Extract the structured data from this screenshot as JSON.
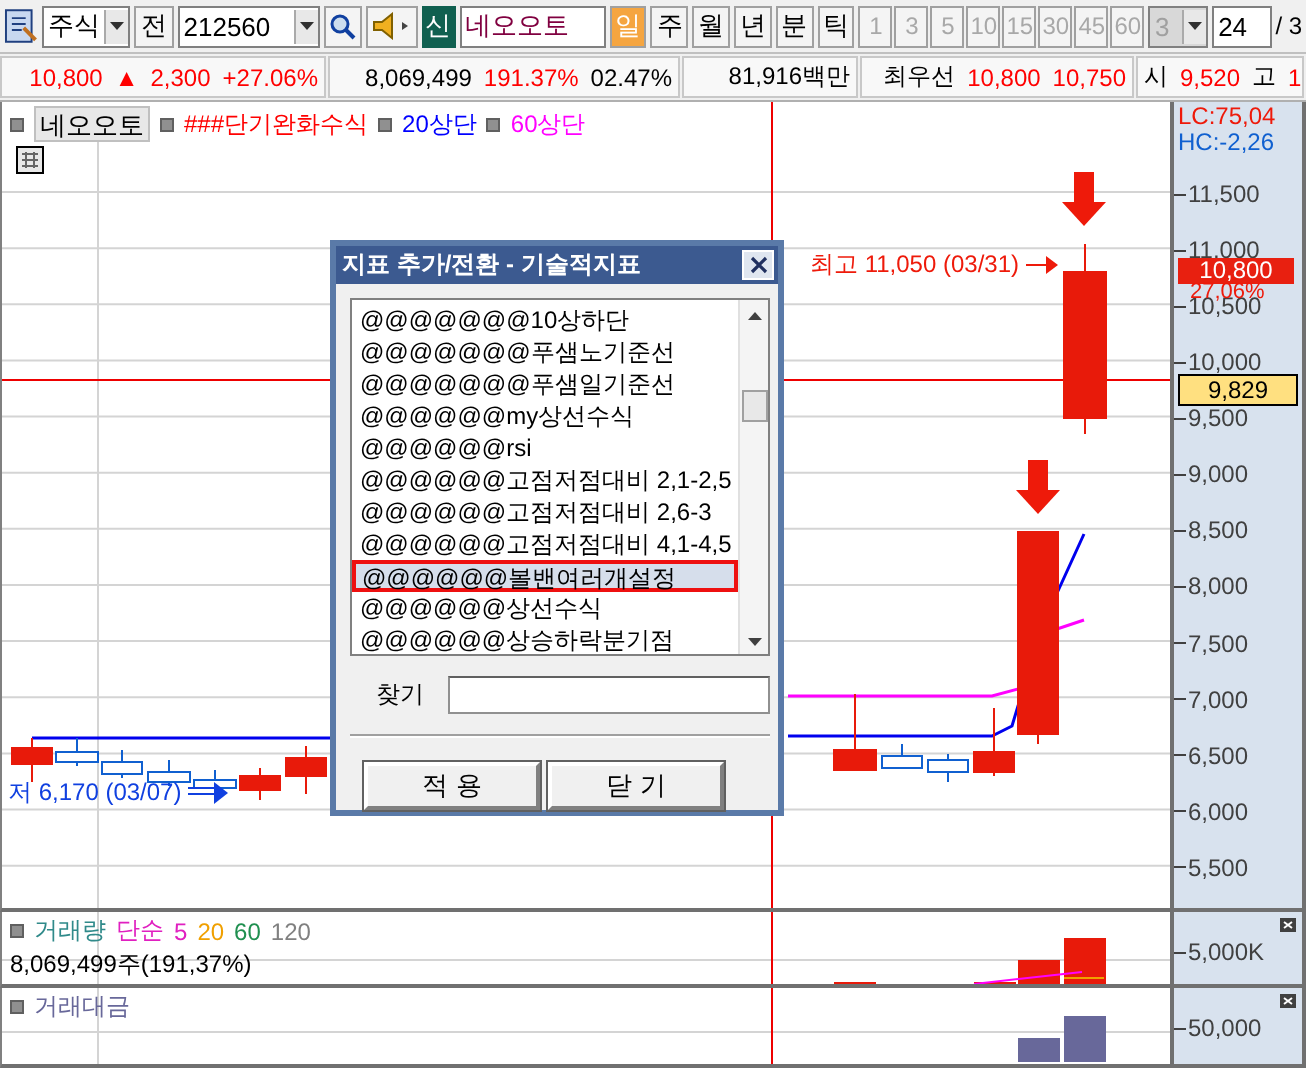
{
  "toolbar": {
    "market": "주식",
    "prev_button": "전",
    "code": "212560",
    "badge": "신",
    "name": "네오오토",
    "periods": [
      {
        "label": "일",
        "selected": true
      },
      {
        "label": "주",
        "selected": false
      },
      {
        "label": "월",
        "selected": false
      },
      {
        "label": "년",
        "selected": false
      },
      {
        "label": "분",
        "selected": false
      },
      {
        "label": "틱",
        "selected": false
      }
    ],
    "intervals": [
      {
        "label": "1",
        "disabled": true
      },
      {
        "label": "3",
        "disabled": true
      },
      {
        "label": "5",
        "disabled": true
      },
      {
        "label": "10",
        "disabled": true
      },
      {
        "label": "15",
        "disabled": true
      },
      {
        "label": "30",
        "disabled": true
      },
      {
        "label": "45",
        "disabled": true
      },
      {
        "label": "60",
        "disabled": true
      }
    ],
    "interval_select": {
      "value": "3",
      "disabled": true
    },
    "count": "24",
    "page": "/ 3"
  },
  "quote": {
    "price": "10,800",
    "change_sign": "▲",
    "change": "2,300",
    "change_pct": "+27.06%",
    "volume": "8,069,499",
    "volume_ratio": "191.37%",
    "turnover": "02.47%",
    "amount": "81,916백만",
    "best_label": "최우선",
    "best_ask": "10,800",
    "best_bid": "10,750",
    "open_label": "시",
    "open": "9,520",
    "high_label": "고",
    "high": "1"
  },
  "price_panel": {
    "legend": [
      {
        "label": "네오오토",
        "kind": "button",
        "color": "#000000"
      },
      {
        "label": "###단기완화수식",
        "kind": "text",
        "color": "#ff0000"
      },
      {
        "label": "20상단",
        "kind": "text",
        "color": "#0000ff"
      },
      {
        "label": "60상단",
        "kind": "text",
        "color": "#ff00ff"
      }
    ],
    "high_note": "최고 11,050 (03/31)",
    "low_note": "저 6,170 (03/07)",
    "lc": "LC:75,04",
    "hc": "HC:-2,26",
    "ticks": [
      "11,500",
      "11,000",
      "10,500",
      "10,000",
      "9,500",
      "9,000",
      "8,500",
      "8,000",
      "7,500",
      "7,000",
      "6,500",
      "6,000",
      "5,500"
    ],
    "last_price": "10,800",
    "last_pct": "27,06%",
    "cursor_price": "9,829"
  },
  "volume_panel": {
    "title": "거래량",
    "ma_label": "단순",
    "ma": [
      {
        "label": "5",
        "color": "#e020c0"
      },
      {
        "label": "20",
        "color": "#f0a000"
      },
      {
        "label": "60",
        "color": "#209050"
      },
      {
        "label": "120",
        "color": "#808080"
      }
    ],
    "reading": "8,069,499주(191,37%)",
    "tick": "5,000K"
  },
  "amount_panel": {
    "title": "거래대금",
    "tick": "50,000"
  },
  "dialog": {
    "title": "지표 추가/전환 - 기술적지표",
    "items": [
      {
        "label": "@@@@@@@10상하단",
        "selected": false
      },
      {
        "label": "@@@@@@@푸샘노기준선",
        "selected": false
      },
      {
        "label": "@@@@@@@푸샘일기준선",
        "selected": false
      },
      {
        "label": "@@@@@@my상선수식",
        "selected": false
      },
      {
        "label": "@@@@@@rsi",
        "selected": false
      },
      {
        "label": "@@@@@@고점저점대비 2,1-2,5",
        "selected": false
      },
      {
        "label": "@@@@@@고점저점대비 2,6-3",
        "selected": false
      },
      {
        "label": "@@@@@@고점저점대비 4,1-4,5",
        "selected": false
      },
      {
        "label": "@@@@@@볼밴여러개설정",
        "selected": true
      },
      {
        "label": "@@@@@@상선수식",
        "selected": false
      },
      {
        "label": "@@@@@@상승하락분기점",
        "selected": false
      }
    ],
    "search_label": "찾기",
    "buttons": [
      "적 용",
      "닫 기"
    ]
  }
}
